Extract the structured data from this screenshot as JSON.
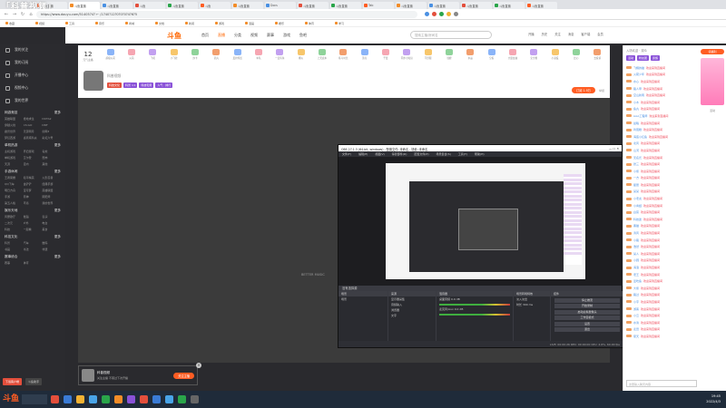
{
  "browser": {
    "overlay_text": "「科普视频」",
    "tabs": [
      "斗鱼直播",
      "斗鱼直播",
      "斗鱼直播",
      "斗鱼",
      "斗鱼直播",
      "斗鱼",
      "斗鱼直播",
      "Docs",
      "斗鱼直播",
      "斗鱼直播",
      "Tab",
      "斗鱼直播",
      "斗鱼直播",
      "斗鱼直播",
      "斗鱼直播",
      "斗鱼直播"
    ],
    "url": "https://www.douyu.com/5140574?   ← /1740?12?0?0?0?4?6?5",
    "bookmarks": [
      "收藏",
      "视频",
      "工具",
      "音乐",
      "商城",
      "文档",
      "新闻",
      "游戏",
      "漫画",
      "娱乐",
      "体育",
      "学习"
    ]
  },
  "sidebar": {
    "items": [
      "我的关注",
      "我的订阅",
      "开播中心",
      "视频中心",
      "我的世界"
    ],
    "sections": [
      {
        "title": "网游竞技",
        "more": "更多",
        "entries": [
          "英雄联盟",
          "绝地求生",
          "DOTA2",
          "穿越火线",
          "CS:GO",
          "DNF",
          "魔兽世界",
          "天涯明月",
          "剑网3",
          "梦幻西游",
          "逃离塔科夫",
          "彩虹六号"
        ]
      },
      {
        "title": "单机热游",
        "more": "更多",
        "entries": [
          "主机游戏",
          "怀旧游戏",
          "毒蛇",
          "单机游戏",
          "艾尔登",
          "恐怖",
          "天涯",
          "室内",
          "其他"
        ]
      },
      {
        "title": "手游休闲",
        "more": "更多",
        "entries": [
          "王者荣耀",
          "和平精英",
          "火影忍者",
          "QQ飞车",
          "金铲铲",
          "经典手游",
          "明日方舟",
          "宝可梦",
          "英雄联盟",
          "手游",
          "原神",
          "阴阳师",
          "第五人格",
          "环境",
          "我的世界"
        ]
      },
      {
        "title": "娱乐天地",
        "more": "更多",
        "entries": [
          "风靡歌厅",
          "舞蹈",
          "表演",
          "二次元",
          "户外",
          "电台",
          "科技",
          "一起看",
          "美食"
        ]
      },
      {
        "title": "科技文化",
        "more": "更多",
        "entries": [
          "科普",
          "汽车",
          "数码",
          "书画",
          "书法",
          "非遗"
        ]
      },
      {
        "title": "赛事综合",
        "more": "更多",
        "entries": [
          "赛事",
          "体育"
        ]
      }
    ],
    "bottom_btn1": "下载客户端",
    "bottom_btn2": "斗鱼助手"
  },
  "sitenav": {
    "logo": "斗鱼",
    "links": [
      "首页",
      "直播",
      "分类",
      "视频",
      "赛事",
      "游戏",
      "鱼吧"
    ],
    "active": "直播",
    "search_placeholder": "搜索主播/房间名",
    "icons": [
      "开播",
      "历史",
      "关注",
      "消息",
      "客户端",
      "会员"
    ]
  },
  "room": {
    "level_num": "12",
    "level_label": "元气主播",
    "gifts": [
      "超级火箭",
      "火箭",
      "飞机",
      "小飞硅",
      "办卡",
      "药丸",
      "爱的传送",
      "车队",
      "一定有鱼",
      "爆火",
      "上天底车",
      "练习时长",
      "漂亮",
      "干渡",
      "同步小知识",
      "不舒服",
      "锦鲤",
      "水晶",
      "空投",
      "大量加油",
      "安全帽",
      "小退役",
      "比心",
      "去投诉"
    ],
    "streamer_name": "科普视频",
    "tags": [
      "科技文化",
      "科普 ×1",
      "科技宅男",
      "人气 · 排行"
    ],
    "subscribe": "订阅 1.9万",
    "report": "举报"
  },
  "video": {
    "caption": "BETTER MUSIC"
  },
  "obs": {
    "title": "OBS 27.1.3 (64-bit, windows) - 配置文件: 未命名 - 场景: 未命名",
    "menu": [
      "文件(F)",
      "编辑(E)",
      "视图(V)",
      "停靠部件(D)",
      "配置文件(P)",
      "场景集合(S)",
      "工具(T)",
      "帮助(H)"
    ],
    "scene_label": "没有选择源",
    "docks": [
      {
        "title": "场景",
        "rows": [
          "场景"
        ]
      },
      {
        "title": "来源",
        "rows": [
          "显示器采集",
          "音频输入",
          "浏览器",
          "文字"
        ]
      },
      {
        "title": "混音器",
        "rows": [
          "桌面音频  0.0 dB",
          "麦克风/Aux  0.0 dB"
        ]
      },
      {
        "title": "场景转场特效",
        "rows": [
          "淡入淡出",
          "时长  300 ms"
        ]
      },
      {
        "title": "控件",
        "buttons": [
          "停止推流",
          "开始录制",
          "启动虚拟摄像头",
          "工作室模式",
          "设置",
          "退出"
        ]
      }
    ],
    "status": "LIVE: 00:00:26   REC: 00:00:00   CPU: 4.6%, 60.00 fps"
  },
  "chat": {
    "header": "入场欢迎 · 观众",
    "tabs": [
      "活动",
      "粉丝团",
      "贵族"
    ],
    "messages": [
      {
        "nick": "飞翔的猫",
        "text": "欢迎来到直播间"
      },
      {
        "nick": "火箭少年",
        "text": "欢迎来到直播间"
      },
      {
        "nick": "水心",
        "text": "欢迎来到直播间"
      },
      {
        "nick": "路人甲",
        "text": "欢迎来到直播间"
      },
      {
        "nick": "空山新雨",
        "text": "欢迎来到直播间"
      },
      {
        "nick": "小木",
        "text": "欢迎来到直播间"
      },
      {
        "nick": "鱼丸",
        "text": "欢迎来到直播间"
      },
      {
        "nick": "AAA工程师",
        "text": "欢迎来到直播间"
      },
      {
        "nick": "晨曦",
        "text": "欢迎来到直播间"
      },
      {
        "nick": "鸡蛋糕",
        "text": "欢迎来到直播间"
      },
      {
        "nick": "海底小红鱼",
        "text": "欢迎来到直播间"
      },
      {
        "nick": "北风",
        "text": "欢迎来到直播间"
      },
      {
        "nick": "山河",
        "text": "欢迎来到直播间"
      },
      {
        "nick": "无名氏",
        "text": "欢迎来到直播间"
      },
      {
        "nick": "张三",
        "text": "欢迎来到直播间"
      },
      {
        "nick": "小熊",
        "text": "欢迎来到直播间"
      },
      {
        "nick": "一方",
        "text": "欢迎来到直播间"
      },
      {
        "nick": "星辰",
        "text": "欢迎来到直播间"
      },
      {
        "nick": "某某",
        "text": "欢迎来到直播间"
      },
      {
        "nick": "小老虎",
        "text": "欢迎来到直播间"
      },
      {
        "nick": "小青蛙",
        "text": "欢迎来到直播间"
      },
      {
        "nick": "白菜",
        "text": "欢迎来到直播间"
      },
      {
        "nick": "科技迷",
        "text": "欢迎来到直播间"
      },
      {
        "nick": "黑猫",
        "text": "欢迎来到直播间"
      },
      {
        "nick": "清风",
        "text": "欢迎来到直播间"
      },
      {
        "nick": "小路",
        "text": "欢迎来到直播间"
      },
      {
        "nick": "浩然",
        "text": "欢迎来到直播间"
      },
      {
        "nick": "某人",
        "text": "欢迎来到直播间"
      },
      {
        "nick": "小圆",
        "text": "欢迎来到直播间"
      },
      {
        "nick": "海浪",
        "text": "欢迎来到直播间"
      },
      {
        "nick": "老王",
        "text": "欢迎来到直播间"
      },
      {
        "nick": "爱吃鱼",
        "text": "欢迎来到直播间"
      },
      {
        "nick": "大熊",
        "text": "欢迎来到直播间"
      },
      {
        "nick": "路过",
        "text": "欢迎来到直播间"
      },
      {
        "nick": "小宇",
        "text": "欢迎来到直播间"
      },
      {
        "nick": "游客",
        "text": "欢迎来到直播间"
      },
      {
        "nick": "小云",
        "text": "欢迎来到直播间"
      },
      {
        "nick": "水滴",
        "text": "欢迎来到直播间"
      },
      {
        "nick": "麦田",
        "text": "欢迎来到直播间"
      },
      {
        "nick": "夏天",
        "text": "欢迎来到直播间"
      }
    ],
    "input_placeholder": "这里输入聊天内容"
  },
  "ad": {
    "button": "领福利",
    "caption": "活动"
  },
  "popup": {
    "name": "科普视频",
    "sub": "关注主播 不错过下次开播",
    "button": "关注主播"
  },
  "taskbar": {
    "start_label": "斗鱼",
    "time": "19:45",
    "date": "2022/4/3",
    "app_colors": [
      "#e34f3c",
      "#3a7bd5",
      "#f2b233",
      "#49a4e8",
      "#2aa54a",
      "#f28c28",
      "#8a52d8",
      "#e34f3c",
      "#3a7bd5",
      "#49a4e8",
      "#2aa54a",
      "#666666"
    ]
  }
}
